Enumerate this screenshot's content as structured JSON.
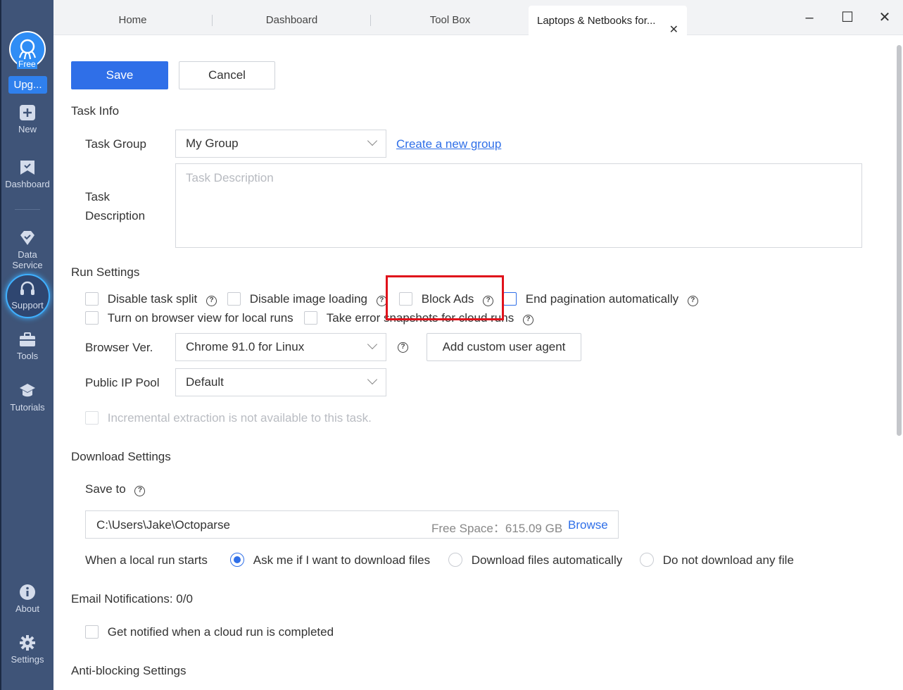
{
  "sidebar": {
    "avatar_tag": "Free",
    "upgrade_label": "Upg...",
    "items": [
      {
        "label": "New",
        "icon": "plus-square-icon"
      },
      {
        "label": "Dashboard",
        "icon": "bookmark-icon"
      },
      {
        "label": "Data Service",
        "icon": "diamond-icon"
      },
      {
        "label": "Support",
        "icon": "headset-icon"
      },
      {
        "label": "Tools",
        "icon": "toolbox-icon"
      },
      {
        "label": "Tutorials",
        "icon": "graduation-cap-icon"
      },
      {
        "label": "About",
        "icon": "info-icon"
      },
      {
        "label": "Settings",
        "icon": "gear-icon"
      }
    ]
  },
  "tabs": [
    {
      "label": "Home"
    },
    {
      "label": "Dashboard"
    },
    {
      "label": "Tool Box"
    },
    {
      "label": "Laptops & Netbooks for..."
    }
  ],
  "window": {
    "minimize": "–",
    "maximize": "☐",
    "close": "✕"
  },
  "toolbar": {
    "save_label": "Save",
    "cancel_label": "Cancel"
  },
  "task_info": {
    "title": "Task Info",
    "group_label": "Task Group",
    "group_value": "My Group",
    "create_group_link": "Create a new group",
    "description_label_line1": "Task",
    "description_label_line2": "Description",
    "description_placeholder": "Task Description"
  },
  "run_settings": {
    "title": "Run Settings",
    "disable_task_split": "Disable task split",
    "disable_image_loading": "Disable image loading",
    "block_ads": "Block Ads",
    "end_pagination": "End pagination automatically",
    "browser_view_local": "Turn on browser view for local runs",
    "error_snapshots": "Take error snapshots for cloud runs",
    "browser_ver_label": "Browser Ver.",
    "browser_ver_value": "Chrome 91.0 for Linux",
    "custom_agent_button": "Add custom user agent",
    "ip_pool_label": "Public IP Pool",
    "ip_pool_value": "Default",
    "incremental_note": "Incremental extraction is not available to this task."
  },
  "download_settings": {
    "title": "Download Settings",
    "save_to_label": "Save to",
    "path": "C:\\Users\\Jake\\Octoparse",
    "free_space": "Free Space：615.09 GB",
    "browse": "Browse",
    "local_run_label": "When a local run starts",
    "options": [
      {
        "label": "Ask me if I want to download files",
        "selected": true
      },
      {
        "label": "Download files automatically",
        "selected": false
      },
      {
        "label": "Do not download any file",
        "selected": false
      }
    ]
  },
  "email": {
    "title": "Email Notifications: 0/0",
    "notify_label": "Get notified when a cloud run is completed"
  },
  "anti_blocking": {
    "title": "Anti-blocking Settings"
  },
  "colors": {
    "accent": "#2f6fe8",
    "sidebar": "#3f5478",
    "highlight": "#e0121b"
  }
}
